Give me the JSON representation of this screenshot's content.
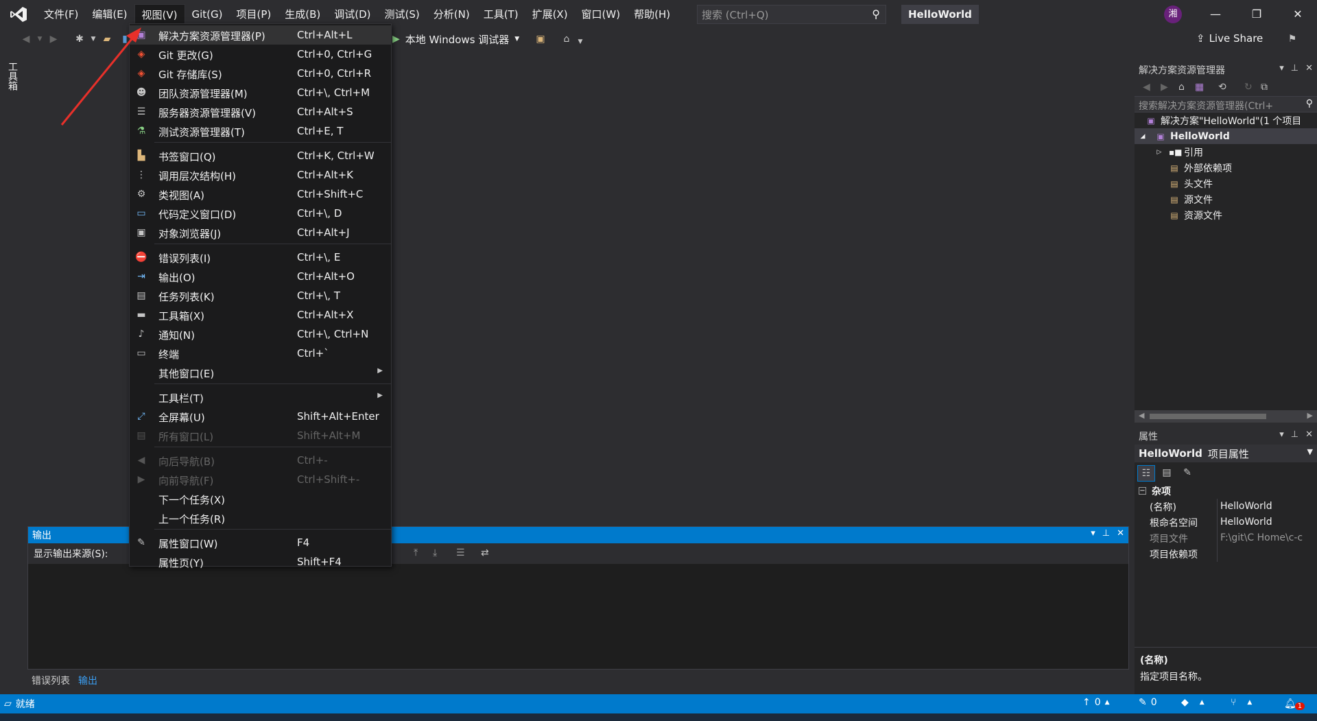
{
  "titlebar": {
    "menu": [
      "文件(F)",
      "编辑(E)",
      "视图(V)",
      "Git(G)",
      "项目(P)",
      "生成(B)",
      "调试(D)",
      "测试(S)",
      "分析(N)",
      "工具(T)",
      "扩展(X)",
      "窗口(W)",
      "帮助(H)"
    ],
    "search_placeholder": "搜索 (Ctrl+Q)",
    "solution_name": "HelloWorld",
    "avatar_initial": "湘",
    "icons": {
      "minimize": "minimize-icon",
      "maximize": "restore-icon",
      "close": "close-icon"
    }
  },
  "toolbar": {
    "debug_target": "本地 Windows 调试器",
    "live_share": "Live Share"
  },
  "toolbox_label": "工具箱",
  "view_menu": {
    "items": [
      {
        "label": "解决方案资源管理器(P)",
        "shortcut": "Ctrl+Alt+L",
        "icon": "solution-explorer-icon",
        "highlight": true
      },
      {
        "label": "Git 更改(G)",
        "shortcut": "Ctrl+0, Ctrl+G",
        "icon": "git-changes-icon"
      },
      {
        "label": "Git 存储库(S)",
        "shortcut": "Ctrl+0, Ctrl+R",
        "icon": "git-repository-icon"
      },
      {
        "label": "团队资源管理器(M)",
        "shortcut": "Ctrl+\\, Ctrl+M",
        "icon": "team-explorer-icon"
      },
      {
        "label": "服务器资源管理器(V)",
        "shortcut": "Ctrl+Alt+S",
        "icon": "server-explorer-icon"
      },
      {
        "label": "测试资源管理器(T)",
        "shortcut": "Ctrl+E, T",
        "icon": "test-explorer-icon"
      },
      {
        "separator": true
      },
      {
        "label": "书签窗口(Q)",
        "shortcut": "Ctrl+K, Ctrl+W",
        "icon": "bookmark-icon"
      },
      {
        "label": "调用层次结构(H)",
        "shortcut": "Ctrl+Alt+K",
        "icon": "call-hierarchy-icon"
      },
      {
        "label": "类视图(A)",
        "shortcut": "Ctrl+Shift+C",
        "icon": "class-view-icon"
      },
      {
        "label": "代码定义窗口(D)",
        "shortcut": "Ctrl+\\, D",
        "icon": "code-definition-icon"
      },
      {
        "label": "对象浏览器(J)",
        "shortcut": "Ctrl+Alt+J",
        "icon": "object-browser-icon"
      },
      {
        "separator": true
      },
      {
        "label": "错误列表(I)",
        "shortcut": "Ctrl+\\, E",
        "icon": "error-list-icon"
      },
      {
        "label": "输出(O)",
        "shortcut": "Ctrl+Alt+O",
        "icon": "output-icon"
      },
      {
        "label": "任务列表(K)",
        "shortcut": "Ctrl+\\, T",
        "icon": "task-list-icon"
      },
      {
        "label": "工具箱(X)",
        "shortcut": "Ctrl+Alt+X",
        "icon": "toolbox-icon"
      },
      {
        "label": "通知(N)",
        "shortcut": "Ctrl+\\, Ctrl+N",
        "icon": "bell-icon"
      },
      {
        "label": "终端",
        "shortcut": "Ctrl+`",
        "icon": "terminal-icon"
      },
      {
        "label": "其他窗口(E)",
        "shortcut": "",
        "icon": "",
        "submenu": true
      },
      {
        "separator": true
      },
      {
        "label": "工具栏(T)",
        "shortcut": "",
        "icon": "",
        "submenu": true
      },
      {
        "label": "全屏幕(U)",
        "shortcut": "Shift+Alt+Enter",
        "icon": "fullscreen-icon"
      },
      {
        "label": "所有窗口(L)",
        "shortcut": "Shift+Alt+M",
        "icon": "all-windows-icon",
        "disabled": true
      },
      {
        "separator": true
      },
      {
        "label": "向后导航(B)",
        "shortcut": "Ctrl+-",
        "icon": "navigate-back-icon",
        "disabled": true
      },
      {
        "label": "向前导航(F)",
        "shortcut": "Ctrl+Shift+-",
        "icon": "navigate-forward-icon",
        "disabled": true
      },
      {
        "label": "下一个任务(X)",
        "shortcut": "",
        "icon": ""
      },
      {
        "label": "上一个任务(R)",
        "shortcut": "",
        "icon": ""
      },
      {
        "separator": true
      },
      {
        "label": "属性窗口(W)",
        "shortcut": "F4",
        "icon": "wrench-icon"
      },
      {
        "label": "属性页(Y)",
        "shortcut": "Shift+F4",
        "icon": ""
      }
    ]
  },
  "output_panel": {
    "title": "输出",
    "source_label": "显示输出来源(S):",
    "tabs": [
      "错误列表",
      "输出"
    ]
  },
  "solution_explorer": {
    "title": "解决方案资源管理器",
    "search_placeholder": "搜索解决方案资源管理器(Ctrl+",
    "solution_row": "解决方案\"HelloWorld\"(1 个项目",
    "project": "HelloWorld",
    "nodes": [
      "引用",
      "外部依赖项",
      "头文件",
      "源文件",
      "资源文件"
    ]
  },
  "properties": {
    "title": "属性",
    "object_name": "HelloWorld",
    "object_type": "项目属性",
    "category": "杂项",
    "rows": [
      {
        "name": "(名称)",
        "value": "HelloWorld"
      },
      {
        "name": "根命名空间",
        "value": "HelloWorld"
      },
      {
        "name": "项目文件",
        "value": "F:\\git\\C Home\\c-c",
        "dim": true
      },
      {
        "name": "项目依赖项",
        "value": ""
      }
    ],
    "desc_title": "(名称)",
    "desc_text": "指定项目名称。"
  },
  "statusbar": {
    "status": "就绪",
    "up_count": "0",
    "pencil_count": "0",
    "notification_count": "1"
  },
  "colors": {
    "accent": "#007acc",
    "background": "#2d2d30",
    "menu_bg": "#1b1b1c",
    "annotation_arrow": "#e8302a"
  }
}
